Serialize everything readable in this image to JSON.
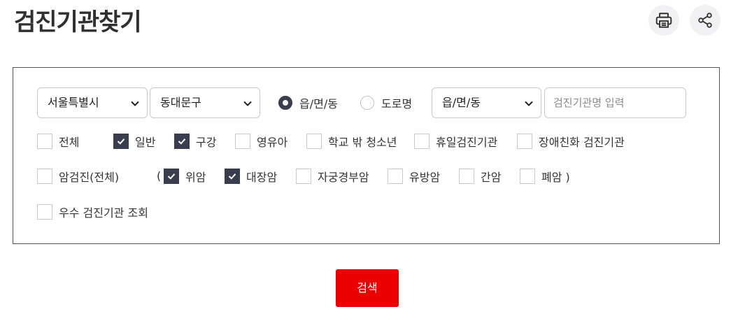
{
  "page": {
    "title": "검진기관찾기"
  },
  "toolbar": {
    "print_icon": "printer-icon",
    "share_icon": "share-icon"
  },
  "form": {
    "city_select": {
      "value": "서울특별시"
    },
    "district_select": {
      "value": "동대문구"
    },
    "address_type": {
      "options": [
        {
          "label": "읍/면/동",
          "selected": true
        },
        {
          "label": "도로명",
          "selected": false
        }
      ]
    },
    "dong_select": {
      "value": "읍/면/동"
    },
    "name_input": {
      "value": "",
      "placeholder": "검진기관명 입력"
    },
    "institution_types": [
      {
        "label": "전체",
        "checked": false
      },
      {
        "label": "일반",
        "checked": true
      },
      {
        "label": "구강",
        "checked": true
      },
      {
        "label": "영유아",
        "checked": false
      },
      {
        "label": "학교 밖 청소년",
        "checked": false
      },
      {
        "label": "휴일검진기관",
        "checked": false
      },
      {
        "label": "장애친화 검진기관",
        "checked": false
      }
    ],
    "cancer_all": {
      "label": "암검진(전체)",
      "checked": false
    },
    "paren_open": "(",
    "cancer_types": [
      {
        "label": "위암",
        "checked": true
      },
      {
        "label": "대장암",
        "checked": true
      },
      {
        "label": "자궁경부암",
        "checked": false
      },
      {
        "label": "유방암",
        "checked": false
      },
      {
        "label": "간암",
        "checked": false
      },
      {
        "label": "폐암 )",
        "checked": false
      }
    ],
    "excellent": {
      "label": "우수 검진기관 조회",
      "checked": false
    }
  },
  "search_button": {
    "label": "검색",
    "color": "#ee0000"
  },
  "colors": {
    "checked": "#3a3d4d",
    "border": "#c9c9c9"
  }
}
